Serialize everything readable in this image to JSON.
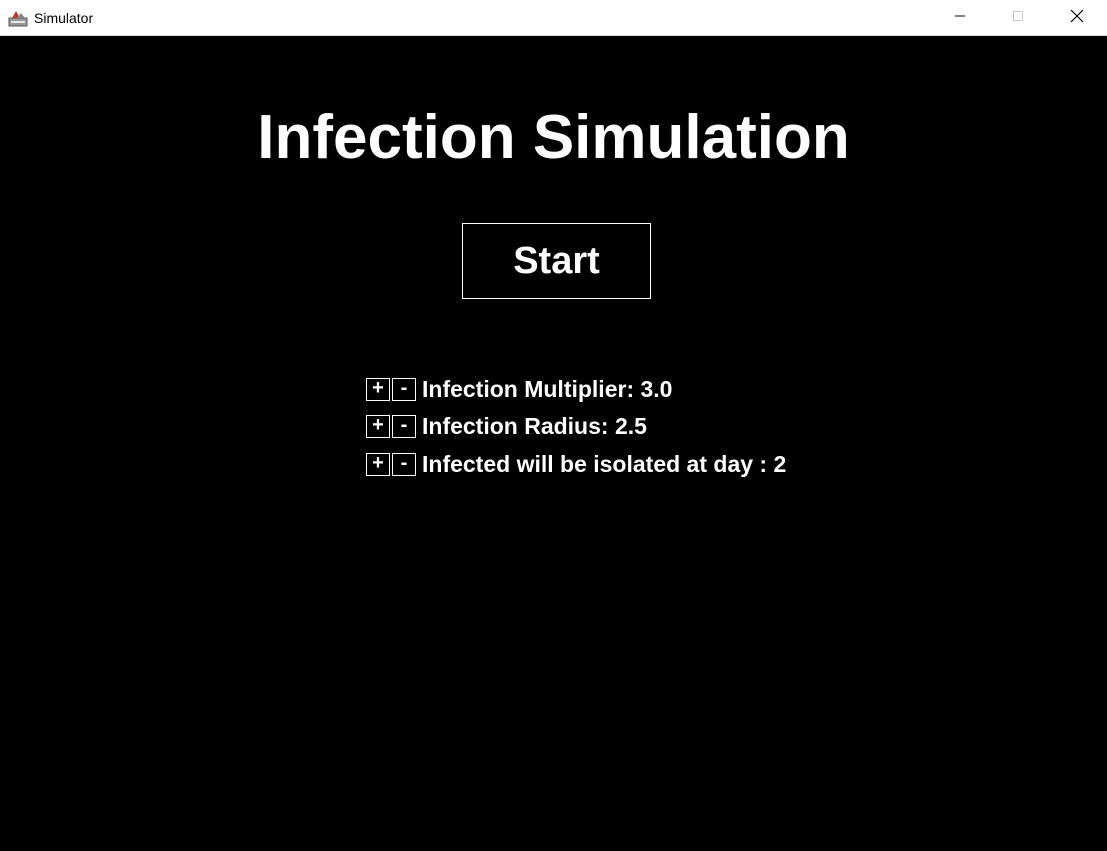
{
  "window": {
    "title": "Simulator",
    "icon": "java-app-icon",
    "controls": {
      "minimize_icon": "minimize-icon",
      "maximize_icon": "maximize-icon",
      "close_icon": "close-icon"
    }
  },
  "main": {
    "title": "Infection Simulation",
    "start_label": "Start",
    "settings": [
      {
        "plus_label": "+",
        "minus_label": "-",
        "label": "Infection Multiplier: 3.0"
      },
      {
        "plus_label": "+",
        "minus_label": "-",
        "label": "Infection Radius: 2.5"
      },
      {
        "plus_label": "+",
        "minus_label": "-",
        "label": "Infected will be isolated at day : 2"
      }
    ]
  },
  "colors": {
    "background": "#000000",
    "foreground": "#ffffff",
    "titlebar": "#ffffff"
  }
}
